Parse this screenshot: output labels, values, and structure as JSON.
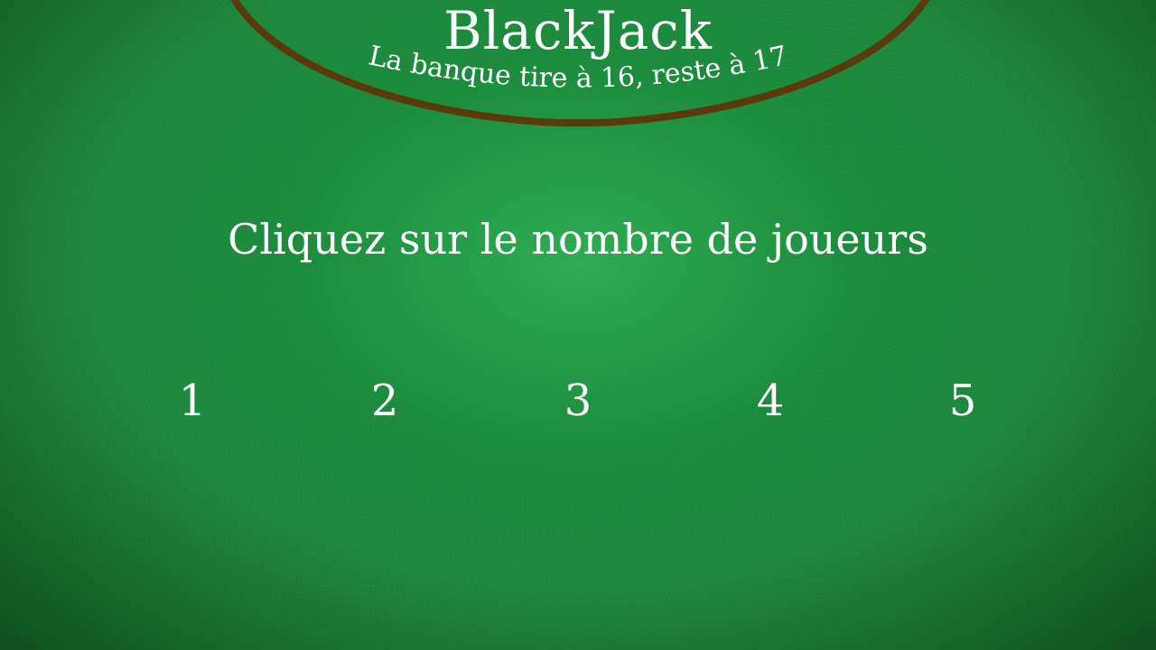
{
  "header": {
    "title": "BlackJack",
    "subtitle": "La banque tire à 16, reste à 17"
  },
  "prompt": "Cliquez sur le nombre de joueurs",
  "player_options": [
    "1",
    "2",
    "3",
    "4",
    "5"
  ],
  "colors": {
    "felt": "#1a8a3a",
    "arc": "#5a3a0c",
    "text": "#ffffff"
  }
}
